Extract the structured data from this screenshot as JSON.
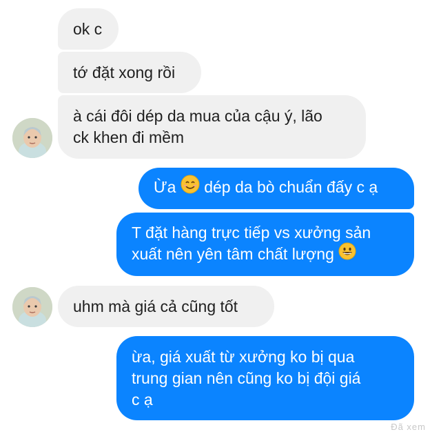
{
  "conversation": {
    "messages": [
      {
        "direction": "incoming",
        "lines": [
          "ok c"
        ]
      },
      {
        "direction": "incoming",
        "lines": [
          "tớ đặt xong rồi"
        ]
      },
      {
        "direction": "incoming",
        "lines": [
          "à cái đôi dép da mua của cậu ý, lão",
          "ck khen đi mềm"
        ]
      },
      {
        "direction": "outgoing",
        "before_emoji": "Ừa ",
        "emoji": "smiling-face-emoji",
        "after_emoji": " dép da bò chuẩn đấy c ạ"
      },
      {
        "direction": "outgoing",
        "lines": [
          "T đặt hàng trực tiếp vs xưởng sản",
          "xuất nên yên tâm chất lượng "
        ],
        "emoji": "grinning-face-emoji"
      },
      {
        "direction": "incoming",
        "lines": [
          "uhm mà giá cả cũng tốt"
        ]
      },
      {
        "direction": "outgoing",
        "lines": [
          "ừa, giá xuất từ xưởng ko bị qua",
          "trung gian nên cũng ko bị đội giá",
          "c ạ"
        ]
      }
    ],
    "seen_status": "Đã xem"
  },
  "colors": {
    "incoming_bubble": "#f0f0f0",
    "outgoing_bubble": "#0b84ff",
    "incoming_text": "#1f1f1f",
    "outgoing_text": "#ffffff"
  }
}
